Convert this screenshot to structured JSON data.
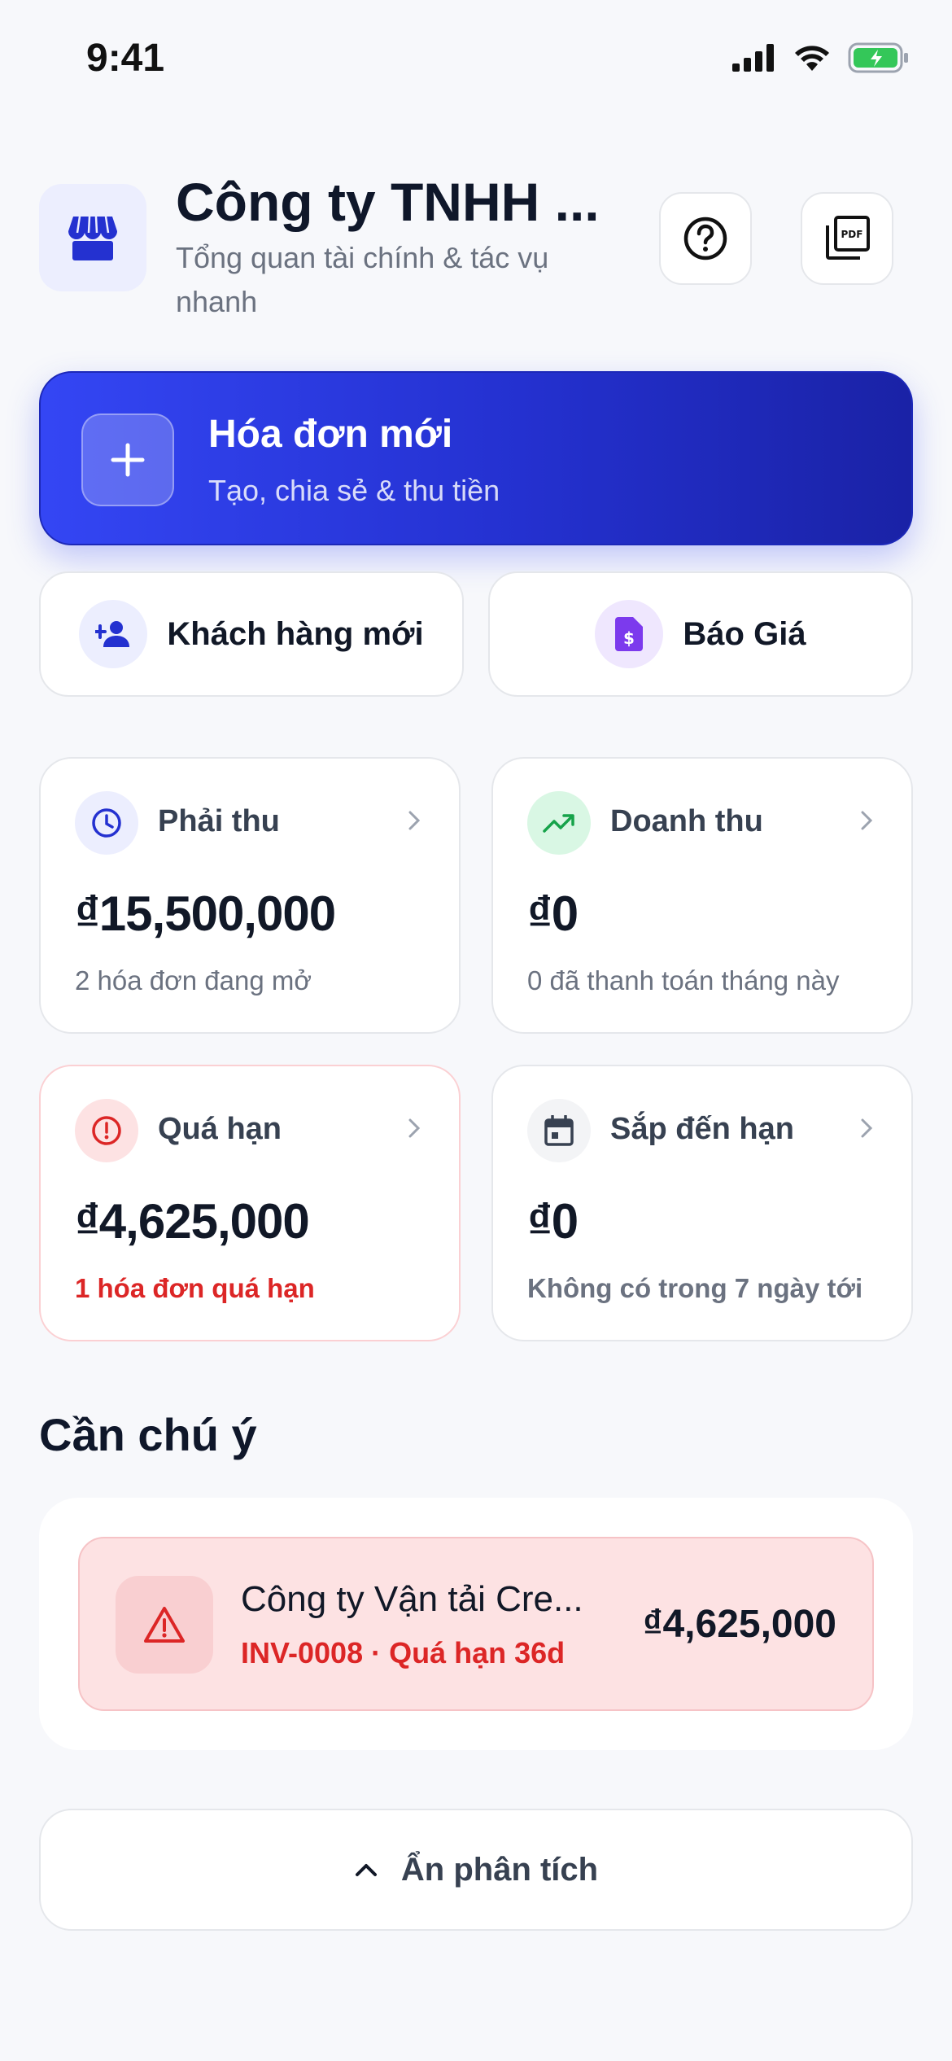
{
  "status_bar": {
    "time": "9:41"
  },
  "header": {
    "title": "Công ty TNHH ...",
    "subtitle": "Tổng quan tài chính & tác vụ nhanh"
  },
  "primary_action": {
    "title": "Hóa đơn mới",
    "subtitle": "Tạo, chia sẻ & thu tiền"
  },
  "secondary_actions": [
    {
      "label": "Khách hàng mới"
    },
    {
      "label": "Báo Giá"
    }
  ],
  "stats": [
    {
      "label": "Phải thu",
      "value": "₫15,500,000",
      "footnote": "2 hóa đơn đang mở"
    },
    {
      "label": "Doanh thu",
      "value": "₫0",
      "footnote": "0 đã thanh toán tháng này"
    },
    {
      "label": "Quá hạn",
      "value": "₫4,625,000",
      "footnote": "1 hóa đơn quá hạn"
    },
    {
      "label": "Sắp đến hạn",
      "value": "₫0",
      "footnote": "Không có trong 7 ngày tới"
    }
  ],
  "attention": {
    "title": "Cần chú ý",
    "items": [
      {
        "name": "Công ty Vận tải Cre...",
        "meta": "INV-0008 · Quá hạn 36d",
        "amount": "₫4,625,000"
      }
    ]
  },
  "toggle": {
    "label": "Ẩn phân tích"
  },
  "colors": {
    "accent": "#3446f4",
    "danger": "#dc2626",
    "success": "#16a34a",
    "purple": "#7c3aed"
  },
  "icons": {
    "header": "store-icon",
    "help": "help-circle-icon",
    "pdf": "pdf-icon",
    "cta": "plus-icon",
    "customer": "person-add-icon",
    "quote": "document-dollar-icon",
    "receivable": "clock-icon",
    "revenue": "trending-up-icon",
    "overdue": "alert-circle-icon",
    "upcoming": "calendar-icon",
    "attention": "warning-triangle-icon",
    "toggle": "chevron-up-icon"
  }
}
